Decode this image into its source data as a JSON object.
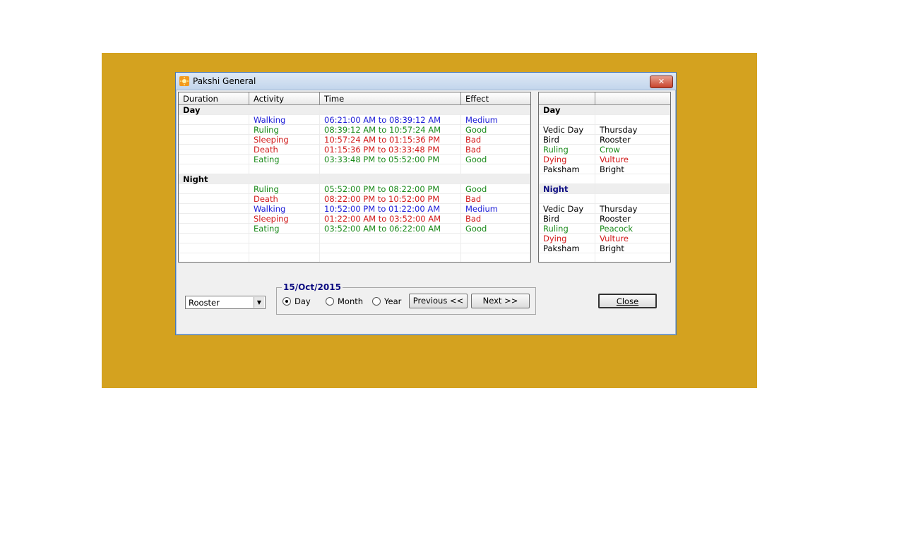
{
  "window": {
    "title": "Pakshi General",
    "close_glyph": "✕"
  },
  "main_table": {
    "headers": [
      "Duration",
      "Activity",
      "Time",
      "Effect"
    ],
    "rows": [
      {
        "type": "section",
        "label": "Day"
      },
      {
        "type": "data",
        "activity": "Walking",
        "time": "06:21:00 AM to 08:39:12 AM",
        "effect": "Medium",
        "color": "blue"
      },
      {
        "type": "data",
        "activity": "Ruling",
        "time": "08:39:12 AM to 10:57:24 AM",
        "effect": "Good",
        "color": "green"
      },
      {
        "type": "data",
        "activity": "Sleeping",
        "time": "10:57:24 AM to 01:15:36 PM",
        "effect": "Bad",
        "color": "red"
      },
      {
        "type": "data",
        "activity": "Death",
        "time": "01:15:36 PM to 03:33:48 PM",
        "effect": "Bad",
        "color": "red"
      },
      {
        "type": "data",
        "activity": "Eating",
        "time": "03:33:48 PM to 05:52:00 PM",
        "effect": "Good",
        "color": "green"
      },
      {
        "type": "blank"
      },
      {
        "type": "section",
        "label": "Night"
      },
      {
        "type": "data",
        "activity": "Ruling",
        "time": "05:52:00 PM to 08:22:00 PM",
        "effect": "Good",
        "color": "green"
      },
      {
        "type": "data",
        "activity": "Death",
        "time": "08:22:00 PM to 10:52:00 PM",
        "effect": "Bad",
        "color": "red"
      },
      {
        "type": "data",
        "activity": "Walking",
        "time": "10:52:00 PM to 01:22:00 AM",
        "effect": "Medium",
        "color": "blue"
      },
      {
        "type": "data",
        "activity": "Sleeping",
        "time": "01:22:00 AM to 03:52:00 AM",
        "effect": "Bad",
        "color": "red"
      },
      {
        "type": "data",
        "activity": "Eating",
        "time": "03:52:00 AM to 06:22:00 AM",
        "effect": "Good",
        "color": "green"
      },
      {
        "type": "blank"
      },
      {
        "type": "blank"
      },
      {
        "type": "blank"
      }
    ]
  },
  "side_table": {
    "headers": [
      "",
      ""
    ],
    "rows": [
      {
        "type": "section",
        "label": "Day",
        "style": "bold"
      },
      {
        "type": "blank"
      },
      {
        "type": "data",
        "key": "Vedic Day",
        "value": "Thursday",
        "color": "black"
      },
      {
        "type": "data",
        "key": "Bird",
        "value": "Rooster",
        "color": "black"
      },
      {
        "type": "data",
        "key": "Ruling",
        "value": "Crow",
        "color": "green"
      },
      {
        "type": "data",
        "key": "Dying",
        "value": "Vulture",
        "color": "red"
      },
      {
        "type": "data",
        "key": "Paksham",
        "value": "Bright",
        "color": "black"
      },
      {
        "type": "blank"
      },
      {
        "type": "section",
        "label": "Night",
        "style": "navy"
      },
      {
        "type": "blank"
      },
      {
        "type": "data",
        "key": "Vedic Day",
        "value": "Thursday",
        "color": "black"
      },
      {
        "type": "data",
        "key": "Bird",
        "value": "Rooster",
        "color": "black"
      },
      {
        "type": "data",
        "key": "Ruling",
        "value": "Peacock",
        "color": "green"
      },
      {
        "type": "data",
        "key": "Dying",
        "value": "Vulture",
        "color": "red"
      },
      {
        "type": "data",
        "key": "Paksham",
        "value": "Bright",
        "color": "black"
      },
      {
        "type": "blank"
      }
    ]
  },
  "controls": {
    "bird_select": "Rooster",
    "date_label": "15/Oct/2015",
    "radio_day": "Day",
    "radio_month": "Month",
    "radio_year": "Year",
    "selected_period": "Day",
    "previous_label": "Previous <<",
    "next_label": "Next >>",
    "close_label": "Close"
  },
  "colors": {
    "backdrop": "#d4a21f",
    "blue": "#1b1bd6",
    "green": "#1a8a1a",
    "red": "#d11a1a"
  }
}
